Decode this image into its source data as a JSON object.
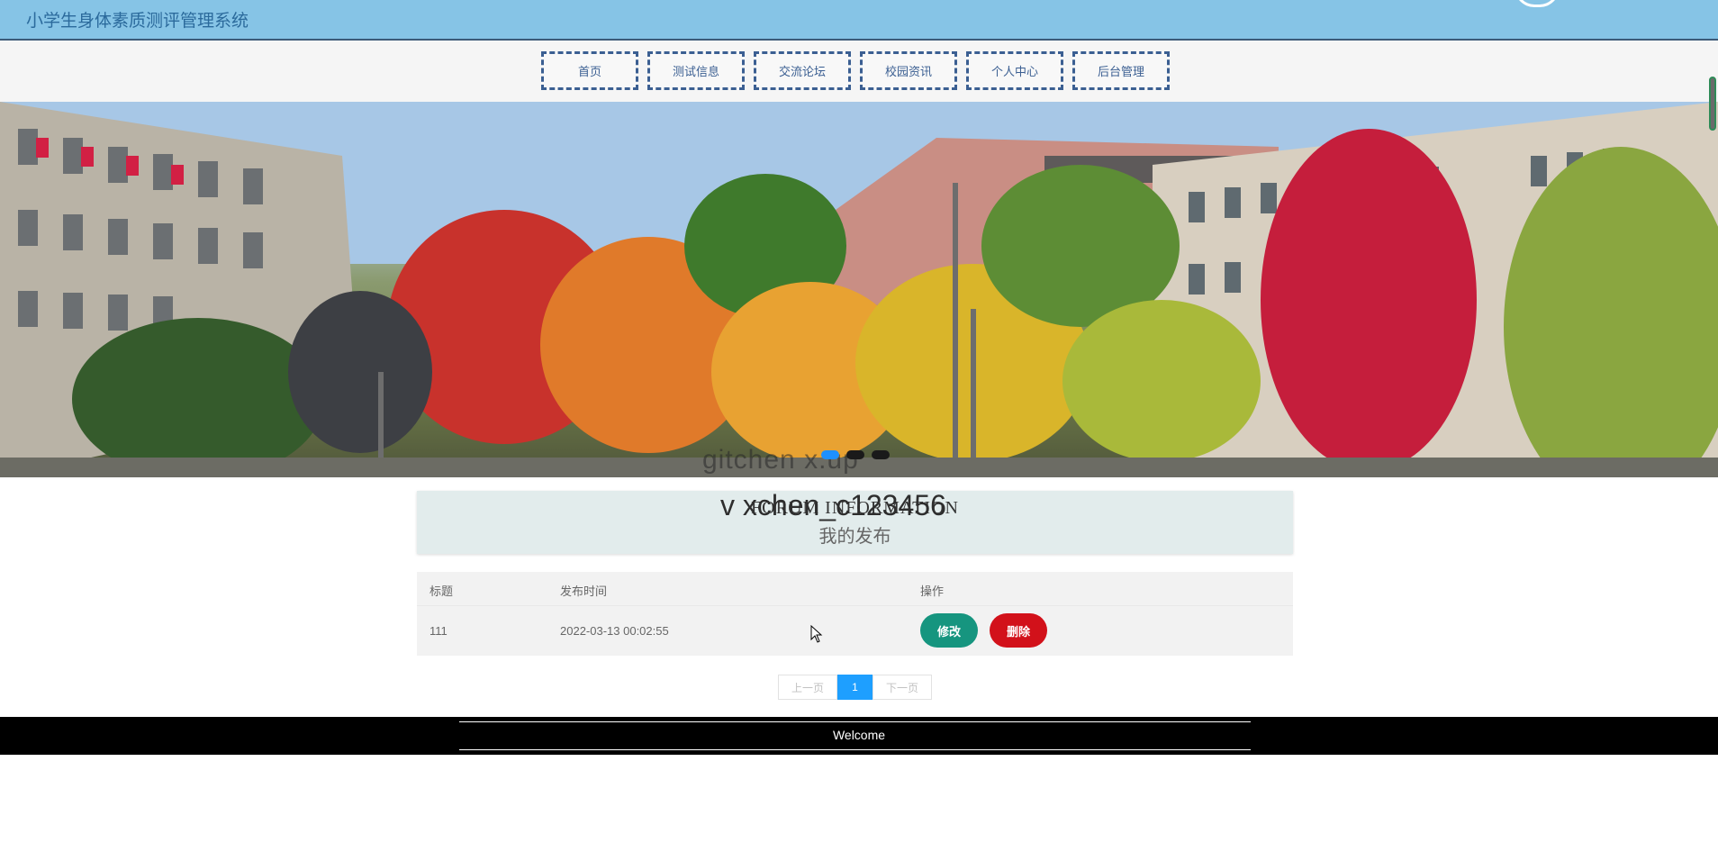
{
  "header": {
    "site_title": "小学生身体素质测评管理系统"
  },
  "nav": {
    "items": [
      {
        "label": "首页"
      },
      {
        "label": "测试信息"
      },
      {
        "label": "交流论坛"
      },
      {
        "label": "校园资讯"
      },
      {
        "label": "个人中心"
      },
      {
        "label": "后台管理"
      }
    ]
  },
  "banner": {
    "overlay_text": "gitchen x.up"
  },
  "section": {
    "title_en": "FORUM INFORMATION",
    "overlay_text": "v xchen_c123456",
    "title_cn": "我的发布"
  },
  "table": {
    "columns": [
      "标题",
      "发布时间",
      "操作"
    ],
    "rows": [
      {
        "title": "111",
        "time": "2022-03-13 00:02:55",
        "edit_label": "修改",
        "delete_label": "删除"
      }
    ]
  },
  "pagination": {
    "prev": "上一页",
    "current": "1",
    "next": "下一页"
  },
  "footer": {
    "text": "Welcome"
  },
  "colors": {
    "header_bg": "#86c4e6",
    "nav_border": "#3b5f92",
    "edit_btn": "#16957f",
    "delete_btn": "#d2111a",
    "pager_active": "#1e9fff"
  }
}
